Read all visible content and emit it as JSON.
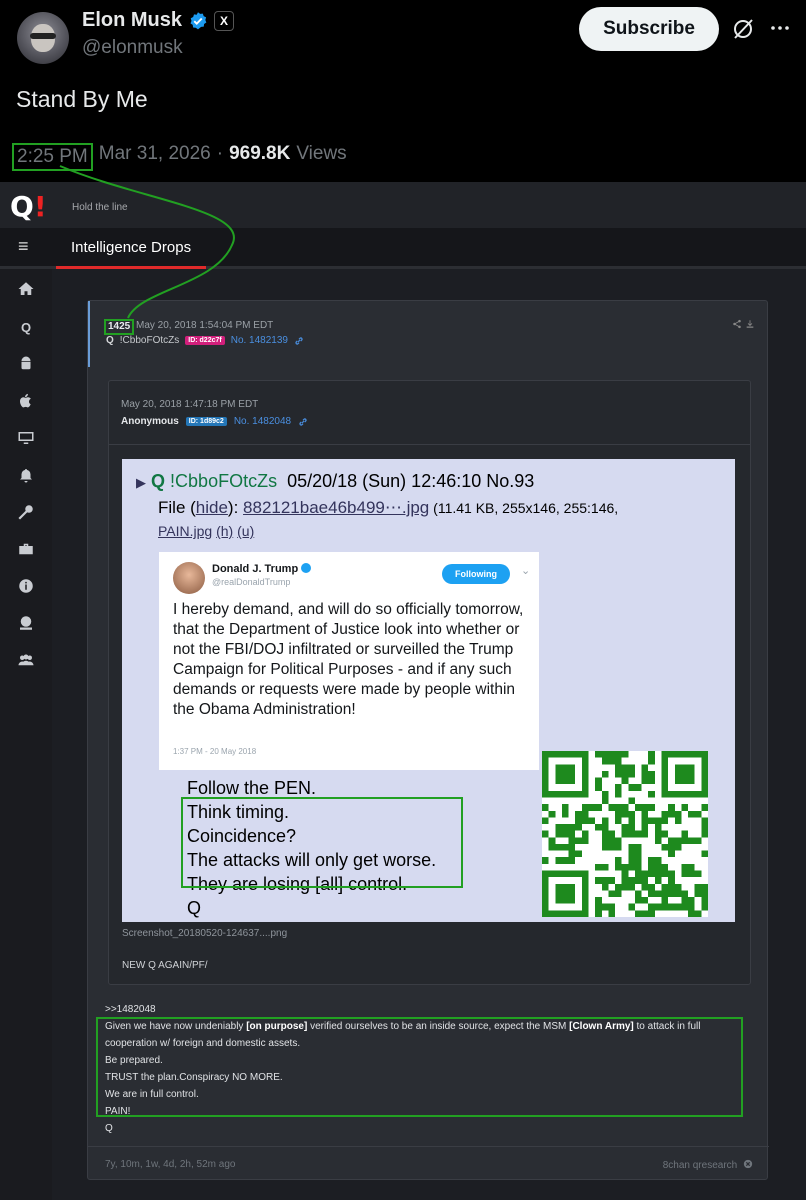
{
  "tweet": {
    "name": "Elon Musk",
    "handle": "@elonmusk",
    "x_badge": "X",
    "subscribe_label": "Subscribe",
    "text": "Stand By Me",
    "time": "2:25 PM",
    "date": "Mar 31, 2026",
    "separator": "·",
    "views_count": "969.8K",
    "views_label": "Views",
    "icons": {
      "verified": "verified-badge-icon",
      "grok": "grok-icon",
      "more": "more-icon"
    },
    "colors": {
      "highlight": "#22a022",
      "verified": "#1d9bf0"
    }
  },
  "screenshot": {
    "logo_q": "Q",
    "logo_bang": "!",
    "tagline": "Hold the line",
    "nav_tab": "Intelligence Drops",
    "sidebar_icons": [
      "home-icon",
      "q-icon",
      "android-icon",
      "apple-icon",
      "desktop-icon",
      "bell-icon",
      "key-icon",
      "toolbox-icon",
      "info-icon",
      "donate-icon",
      "users-icon"
    ],
    "drop": {
      "number": "1425",
      "date": "May 20, 2018 1:54:04 PM EDT",
      "author": "Q",
      "tripcode": "!CbboFOtcZs",
      "id_badge": "ID: d22c7f",
      "post_no": "No. 1482139"
    },
    "reply": {
      "date": "May 20, 2018 1:47:18 PM EDT",
      "author": "Anonymous",
      "id_badge": "ID: 1d89c2",
      "post_no": "No. 1482048",
      "image": {
        "q_name": "Q",
        "tripcode": "!CbboFOtcZs",
        "post_date": "05/20/18 (Sun) 12:46:10 No.93",
        "file_label": "File (",
        "hide": "hide",
        "file_mid": "): ",
        "filename": "882121bae46b499⋯.jpg",
        "file_info": " (11.41 KB, 255x146, 255:146,",
        "file_name2": "PAIN.jpg",
        "h": "(h)",
        "u": "(u)",
        "tweet_name": "Donald J. Trump",
        "tweet_handle": "@realDonaldTrump",
        "tweet_follow": "Following",
        "tweet_text": "I hereby demand, and will do so officially tomorrow, that the Department of Justice look into whether or not the FBI/DOJ infiltrated or surveilled the Trump Campaign for Political Purposes - and if any such demands or requests were made by people within the Obama Administration!",
        "tweet_time": "1:37 PM - 20 May 2018",
        "q_lines": [
          "Follow the PEN.",
          "Think timing.",
          "Coincidence?",
          "The attacks will only get worse.",
          "They are losing [all] control.",
          "Q"
        ]
      },
      "caption": "Screenshot_20180520-124637....png",
      "note": "NEW Q AGAIN/PF/"
    },
    "body": {
      "quote": ">>1482048",
      "line1_a": "Given we have now undeniably ",
      "line1_b": "[on purpose]",
      "line1_c": " verified ourselves to be an inside source, expect the MSM ",
      "line1_d": "[Clown Army]",
      "line1_e": " to attack in full cooperation w/ foreign and domestic assets.",
      "line2": "Be prepared.",
      "line3": "TRUST the plan.Conspiracy NO MORE.",
      "line4": "We are in full control.",
      "line5": "PAIN!",
      "sign": "Q"
    },
    "footer": {
      "ago": "7y, 10m, 1w, 4d, 2h, 52m ago",
      "source": "8chan qresearch"
    }
  }
}
